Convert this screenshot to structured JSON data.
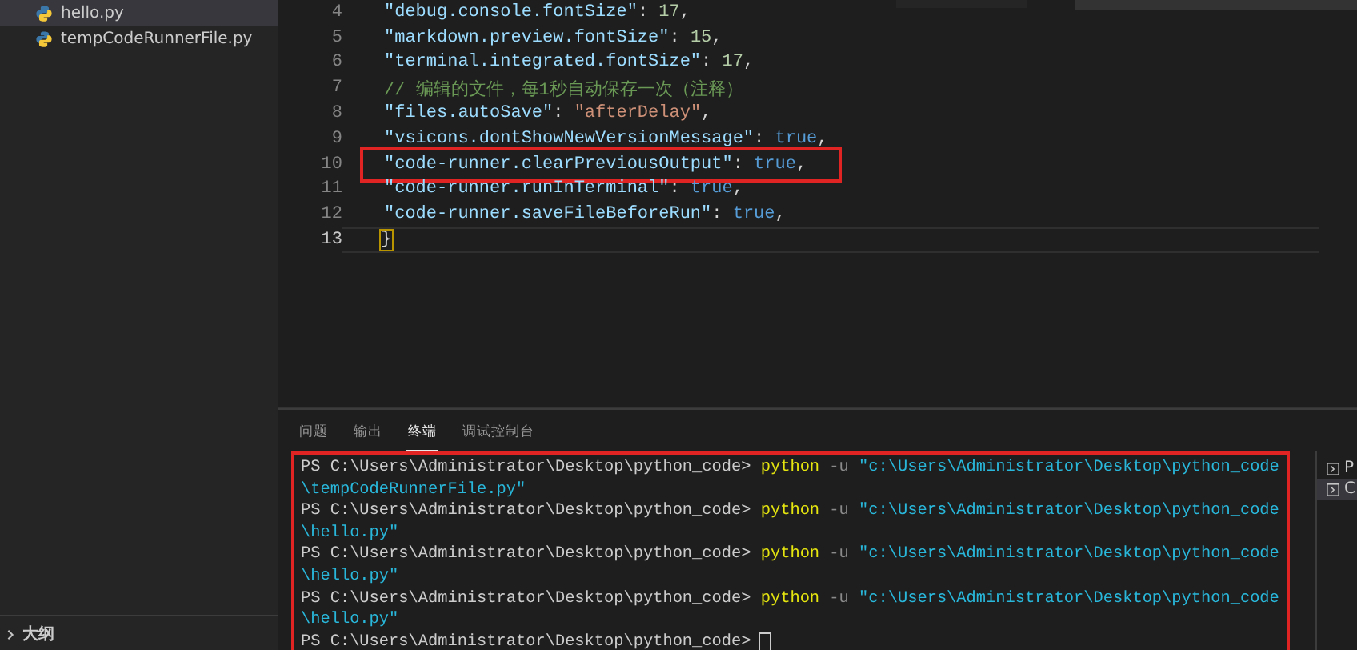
{
  "sidebar": {
    "files": [
      {
        "name": "hello.py",
        "selected": true
      },
      {
        "name": "tempCodeRunnerFile.py",
        "selected": false
      }
    ],
    "outline": {
      "label": "大纲",
      "expanded": false
    }
  },
  "editor": {
    "lines": [
      {
        "number": "4",
        "tokens": [
          {
            "kind": "key",
            "text": "\"debug.console.fontSize\""
          },
          {
            "kind": "punct",
            "text": ": "
          },
          {
            "kind": "number",
            "text": "17"
          },
          {
            "kind": "punct",
            "text": ","
          }
        ]
      },
      {
        "number": "5",
        "tokens": [
          {
            "kind": "key",
            "text": "\"markdown.preview.fontSize\""
          },
          {
            "kind": "punct",
            "text": ": "
          },
          {
            "kind": "number",
            "text": "15"
          },
          {
            "kind": "punct",
            "text": ","
          }
        ]
      },
      {
        "number": "6",
        "tokens": [
          {
            "kind": "key",
            "text": "\"terminal.integrated.fontSize\""
          },
          {
            "kind": "punct",
            "text": ": "
          },
          {
            "kind": "number",
            "text": "17"
          },
          {
            "kind": "punct",
            "text": ","
          }
        ]
      },
      {
        "number": "7",
        "tokens": [
          {
            "kind": "comment",
            "text": "// 编辑的文件，每1秒自动保存一次（注释）"
          }
        ]
      },
      {
        "number": "8",
        "tokens": [
          {
            "kind": "key",
            "text": "\"files.autoSave\""
          },
          {
            "kind": "punct",
            "text": ": "
          },
          {
            "kind": "string",
            "text": "\"afterDelay\""
          },
          {
            "kind": "punct",
            "text": ","
          }
        ]
      },
      {
        "number": "9",
        "tokens": [
          {
            "kind": "key",
            "text": "\"vsicons.dontShowNewVersionMessage\""
          },
          {
            "kind": "punct",
            "text": ": "
          },
          {
            "kind": "bool",
            "text": "true"
          },
          {
            "kind": "punct",
            "text": ","
          }
        ]
      },
      {
        "number": "10",
        "highlighted": true,
        "tokens": [
          {
            "kind": "key",
            "text": "\"code-runner.clearPreviousOutput\""
          },
          {
            "kind": "punct",
            "text": ": "
          },
          {
            "kind": "bool",
            "text": "true"
          },
          {
            "kind": "punct",
            "text": ","
          }
        ]
      },
      {
        "number": "11",
        "tokens": [
          {
            "kind": "key",
            "text": "\"code-runner.runInTerminal\""
          },
          {
            "kind": "punct",
            "text": ": "
          },
          {
            "kind": "bool",
            "text": "true"
          },
          {
            "kind": "punct",
            "text": ","
          }
        ]
      },
      {
        "number": "12",
        "tokens": [
          {
            "kind": "key",
            "text": "\"code-runner.saveFileBeforeRun\""
          },
          {
            "kind": "punct",
            "text": ": "
          },
          {
            "kind": "bool",
            "text": "true"
          },
          {
            "kind": "punct",
            "text": ","
          }
        ]
      },
      {
        "number": "13",
        "current": true,
        "tokens": [
          {
            "kind": "bracket",
            "text": "}"
          }
        ]
      }
    ]
  },
  "panel": {
    "tabs": [
      {
        "label": "问题",
        "selected": false
      },
      {
        "label": "输出",
        "selected": false
      },
      {
        "label": "终端",
        "selected": true
      },
      {
        "label": "调试控制台",
        "selected": false
      }
    ],
    "terminal": {
      "highlighted": true,
      "lines": [
        {
          "kind": "prompt",
          "prompt": "PS C:\\Users\\Administrator\\Desktop\\python_code>",
          "command": "python",
          "flag": "-u",
          "arg": "\"c:\\Users\\Administrator\\Desktop\\python_code"
        },
        {
          "kind": "continuation",
          "arg": "\\tempCodeRunnerFile.py\""
        },
        {
          "kind": "prompt",
          "prompt": "PS C:\\Users\\Administrator\\Desktop\\python_code>",
          "command": "python",
          "flag": "-u",
          "arg": "\"c:\\Users\\Administrator\\Desktop\\python_code"
        },
        {
          "kind": "continuation",
          "arg": "\\hello.py\""
        },
        {
          "kind": "prompt",
          "prompt": "PS C:\\Users\\Administrator\\Desktop\\python_code>",
          "command": "python",
          "flag": "-u",
          "arg": "\"c:\\Users\\Administrator\\Desktop\\python_code"
        },
        {
          "kind": "continuation",
          "arg": "\\hello.py\""
        },
        {
          "kind": "prompt",
          "prompt": "PS C:\\Users\\Administrator\\Desktop\\python_code>",
          "command": "python",
          "flag": "-u",
          "arg": "\"c:\\Users\\Administrator\\Desktop\\python_code"
        },
        {
          "kind": "continuation",
          "arg": "\\hello.py\""
        },
        {
          "kind": "cursor",
          "prompt": "PS C:\\Users\\Administrator\\Desktop\\python_code>"
        }
      ]
    },
    "terminal_list": [
      {
        "label": "P",
        "selected": false
      },
      {
        "label": "C",
        "selected": true
      }
    ]
  }
}
